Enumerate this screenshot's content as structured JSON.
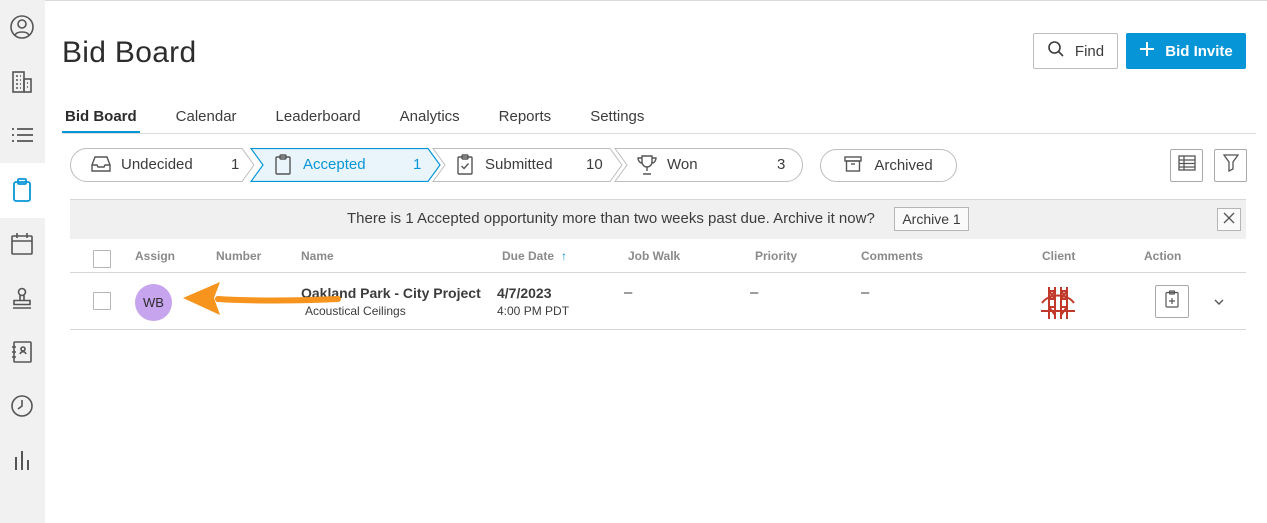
{
  "page": {
    "title": "Bid Board"
  },
  "header": {
    "find_label": "Find",
    "invite_label": "Bid Invite"
  },
  "tabs": [
    {
      "label": "Bid Board",
      "active": true
    },
    {
      "label": "Calendar"
    },
    {
      "label": "Leaderboard"
    },
    {
      "label": "Analytics"
    },
    {
      "label": "Reports"
    },
    {
      "label": "Settings"
    }
  ],
  "pipeline": [
    {
      "label": "Undecided",
      "count": "1",
      "icon": "inbox-icon"
    },
    {
      "label": "Accepted",
      "count": "1",
      "icon": "clipboard-icon",
      "active": true
    },
    {
      "label": "Submitted",
      "count": "10",
      "icon": "clipboard-check-icon"
    },
    {
      "label": "Won",
      "count": "3",
      "icon": "trophy-icon"
    }
  ],
  "archived_label": "Archived",
  "banner": {
    "text": "There is 1 Accepted opportunity more than two weeks past due. Archive it now?",
    "button_label": "Archive 1"
  },
  "table": {
    "columns": [
      "Assign",
      "Number",
      "Name",
      "Due Date",
      "Job Walk",
      "Priority",
      "Comments",
      "Client",
      "Action"
    ],
    "sort_indicator": "↑",
    "rows": [
      {
        "assign_initials": "WB",
        "name": "Oakland Park - City Project",
        "subtitle": "Acoustical Ceilings",
        "due_date": "4/7/2023",
        "due_time": "4:00 PM PDT",
        "job_walk": "–",
        "priority": "–",
        "comments": "–"
      }
    ]
  },
  "colors": {
    "accent": "#0696d7",
    "avatar": "#c7a4ee",
    "annotation_arrow": "#f7941d",
    "client_logo": "#c0392b"
  }
}
